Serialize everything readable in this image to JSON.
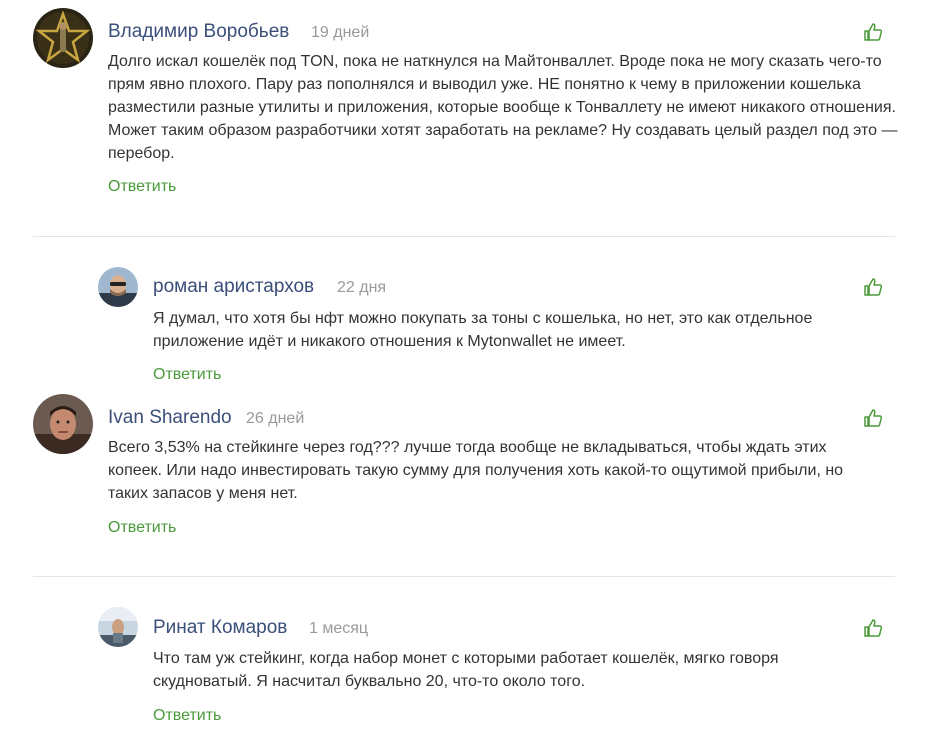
{
  "comments": [
    {
      "author": "Владимир Воробьев",
      "time": "19 дней",
      "text": "Долго искал кошелёк под TON, пока не наткнулся на Майтонваллет. Вроде пока не могу сказать чего-то прям явно плохого. Пару раз пополнялся и выводил уже. НЕ понятно к чему в приложении кошелька разместили разные утилиты и приложения, которые вообще к Тонваллету не имеют никакого отношения. Может таким образом разработчики хотят заработать на рекламе? Ну создавать целый раздел под это — перебор.",
      "reply_label": "Ответить",
      "avatar_icon": "star-avatar-icon"
    },
    {
      "author": "роман аристархов",
      "time": "22 дня",
      "text": "Я думал, что хотя бы нфт можно покупать за тоны с кошелька, но нет, это как отдельное приложение идёт и никакого отношения к Mytonwallet не имеет.",
      "reply_label": "Ответить",
      "avatar_icon": "user-photo-icon"
    },
    {
      "author": "Ivan Sharendo",
      "time": "26 дней",
      "text": "Всего 3,53% на стейкинге через год??? лучше тогда вообще не вкладываться, чтобы ждать этих копеек. Или надо инвестировать такую сумму для получения хоть какой-то ощутимой прибыли, но таких запасов у меня нет.",
      "reply_label": "Ответить",
      "avatar_icon": "user-photo-icon"
    },
    {
      "author": "Ринат Комаров",
      "time": "1 месяц",
      "text": "Что там уж стейкинг, когда набор монет с которыми работает кошелёк, мягко говоря скудноватый. Я насчитал буквально 20, что-то около того.",
      "reply_label": "Ответить",
      "avatar_icon": "user-photo-icon"
    }
  ],
  "like_icon": "thumbs-up-icon",
  "colors": {
    "author": "#3b4f7a",
    "time": "#999999",
    "reply": "#4a9a3a",
    "like": "#4a9a3a",
    "divider": "#e5e5e5"
  }
}
